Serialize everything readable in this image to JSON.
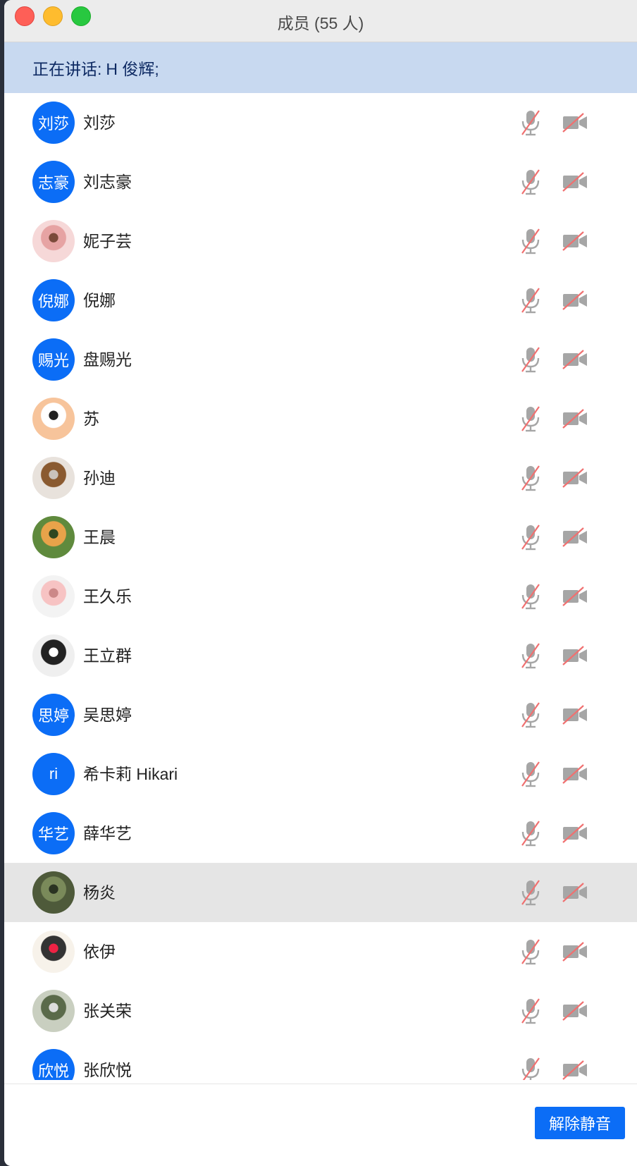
{
  "window": {
    "title": "成员 (55 人)"
  },
  "speaking": {
    "label": "正在讲话:",
    "names": "H 俊辉;"
  },
  "members": [
    {
      "name": "刘莎",
      "avatar_text": "刘莎",
      "avatar_type": "text",
      "avatar_colors": [
        "#0b6df6"
      ]
    },
    {
      "name": "刘志豪",
      "avatar_text": "志豪",
      "avatar_type": "text",
      "avatar_colors": [
        "#0b6df6"
      ]
    },
    {
      "name": "妮子芸",
      "avatar_text": "",
      "avatar_type": "image",
      "avatar_colors": [
        "#f6d8d8",
        "#e6a3a3",
        "#7b4a3a"
      ]
    },
    {
      "name": "倪娜",
      "avatar_text": "倪娜",
      "avatar_type": "text",
      "avatar_colors": [
        "#0b6df6"
      ]
    },
    {
      "name": "盘赐光",
      "avatar_text": "赐光",
      "avatar_type": "text",
      "avatar_colors": [
        "#0b6df6"
      ]
    },
    {
      "name": "苏",
      "avatar_text": "",
      "avatar_type": "image",
      "avatar_colors": [
        "#f7c49b",
        "#ffffff",
        "#222222"
      ]
    },
    {
      "name": "孙迪",
      "avatar_text": "",
      "avatar_type": "image",
      "avatar_colors": [
        "#e8e2dc",
        "#8a5a30",
        "#c9c2bb"
      ]
    },
    {
      "name": "王晨",
      "avatar_text": "",
      "avatar_type": "image",
      "avatar_colors": [
        "#5f8a3d",
        "#e8a34a",
        "#2f4720"
      ]
    },
    {
      "name": "王久乐",
      "avatar_text": "",
      "avatar_type": "image",
      "avatar_colors": [
        "#f3f3f3",
        "#f7c3c3",
        "#c88"
      ]
    },
    {
      "name": "王立群",
      "avatar_text": "",
      "avatar_type": "image",
      "avatar_colors": [
        "#efefef",
        "#222222",
        "#ffffff"
      ]
    },
    {
      "name": "吴思婷",
      "avatar_text": "思婷",
      "avatar_type": "text",
      "avatar_colors": [
        "#0b6df6"
      ]
    },
    {
      "name": "希卡莉 Hikari",
      "avatar_text": "ri",
      "avatar_type": "text",
      "avatar_colors": [
        "#0b6df6"
      ]
    },
    {
      "name": "薛华艺",
      "avatar_text": "华艺",
      "avatar_type": "text",
      "avatar_colors": [
        "#0b6df6"
      ]
    },
    {
      "name": "杨炎",
      "avatar_text": "",
      "avatar_type": "image",
      "avatar_colors": [
        "#4e5a3a",
        "#7a8a5a",
        "#2a3322"
      ],
      "selected": true
    },
    {
      "name": "依伊",
      "avatar_text": "",
      "avatar_type": "image",
      "avatar_colors": [
        "#f7f2ea",
        "#333333",
        "#e24"
      ]
    },
    {
      "name": "张关荣",
      "avatar_text": "",
      "avatar_type": "image",
      "avatar_colors": [
        "#c9cfc0",
        "#5a6a4a",
        "#ddd"
      ]
    },
    {
      "name": "张欣悦",
      "avatar_text": "欣悦",
      "avatar_type": "text",
      "avatar_colors": [
        "#0b6df6"
      ]
    }
  ],
  "footer": {
    "unmute_all_label": "解除静音"
  },
  "colors": {
    "accent": "#0b6df6",
    "speaking_bg": "#c8d9f0",
    "muted_slash": "#f07070",
    "icon_gray": "#a6a6a6"
  },
  "icons": {
    "mic": "mic-muted-icon",
    "camera": "camera-off-icon"
  }
}
